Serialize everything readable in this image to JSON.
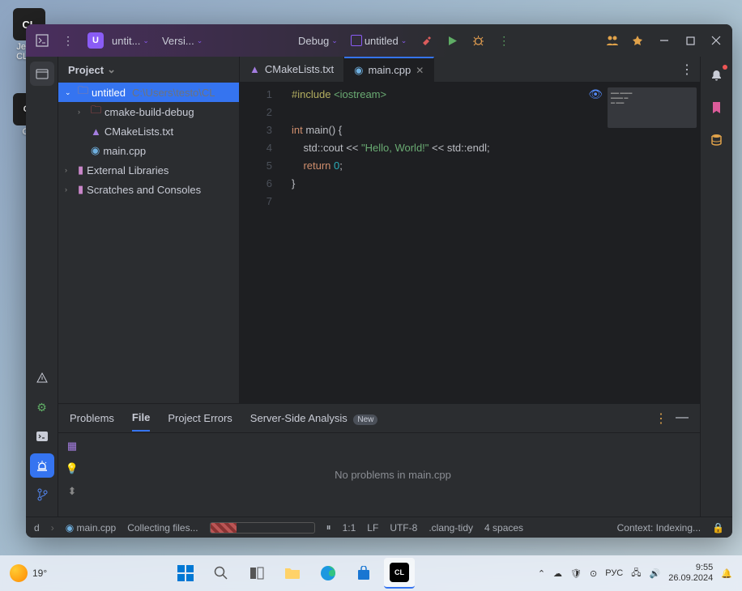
{
  "desktop": {
    "icon1_label": "JetB...\nCLio...",
    "icon1_badge": "CL",
    "icon2_label": "C..."
  },
  "titlebar": {
    "project_letter": "U",
    "project_name": "untit...",
    "vcs_label": "Versi...",
    "config_label": "Debug",
    "run_target": "untitled"
  },
  "project_panel": {
    "title": "Project",
    "root": "untitled",
    "root_path": "C:\\Users\\testo\\CL",
    "items": [
      "cmake-build-debug",
      "CMakeLists.txt",
      "main.cpp"
    ],
    "external": "External Libraries",
    "scratches": "Scratches and Consoles"
  },
  "tabs": {
    "t0": "CMakeLists.txt",
    "t1": "main.cpp"
  },
  "code": {
    "lines": [
      "1",
      "2",
      "3",
      "4",
      "5",
      "6",
      "7"
    ],
    "l1_dir": "#include",
    "l1_inc": "<iostream>",
    "l3_a": "int ",
    "l3_b": "main",
    "l3_c": "() {",
    "l4_a": "    std::cout << ",
    "l4_b": "\"Hello, World!\"",
    "l4_c": " << std::endl;",
    "l5_a": "    ",
    "l5_b": "return ",
    "l5_c": "0",
    "l5_d": ";",
    "l6": "}"
  },
  "problems": {
    "tab0": "Problems",
    "tab1": "File",
    "tab2": "Project Errors",
    "tab3": "Server-Side Analysis",
    "badge": "New",
    "empty": "No problems in main.cpp"
  },
  "status": {
    "nav1": "d",
    "nav2": "main.cpp",
    "task": "Collecting files...",
    "pos": "1:1",
    "eol": "LF",
    "enc": "UTF-8",
    "lint": ".clang-tidy",
    "indent": "4 spaces",
    "ctx": "Context: Indexing..."
  },
  "taskbar": {
    "temp": "19°",
    "lang": "РУС",
    "time": "9:55",
    "date": "26.09.2024"
  }
}
